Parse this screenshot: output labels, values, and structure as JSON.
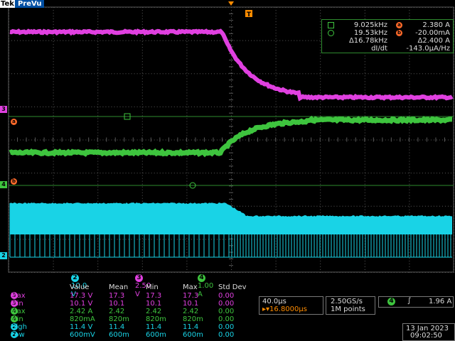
{
  "header": {
    "brand": "Tek",
    "mode": "PreVu"
  },
  "trigger_marker": {
    "label": "T"
  },
  "cursor_readout": {
    "row1": {
      "freq": "9.025kHz",
      "badge": "a",
      "value": "2.380 A"
    },
    "row2": {
      "freq": "19.53kHz",
      "badge": "b",
      "value": "-20.00mA"
    },
    "row3": {
      "freq": "Δ16.78kHz",
      "value": "Δ2.400 A"
    },
    "row4": {
      "label": "dI/dt",
      "value": "-143.0µA/Hz"
    }
  },
  "markers": {
    "ch3": "3",
    "a": "a",
    "ch4": "4",
    "b": "b",
    "ch2": "2"
  },
  "channel_scales": [
    {
      "num": "2",
      "scale": "10.0 V",
      "color": "#19d3e6"
    },
    {
      "num": "3",
      "scale": "2.50 V",
      "color": "#e040e0"
    },
    {
      "num": "4",
      "scale": "1.00 A",
      "color": "#3ec43e"
    }
  ],
  "measurements": {
    "headers": [
      "Value",
      "Mean",
      "Min",
      "Max",
      "Std Dev"
    ],
    "rows": [
      {
        "ch": "3",
        "label": "Max",
        "color": "#e040e0",
        "value": "17.3 V",
        "mean": "17.3",
        "min": "17.3",
        "max": "17.3",
        "std": "0.00"
      },
      {
        "ch": "3",
        "label": "Min",
        "color": "#e040e0",
        "value": "10.1 V",
        "mean": "10.1",
        "min": "10.1",
        "max": "10.1",
        "std": "0.00"
      },
      {
        "ch": "4",
        "label": "Max",
        "color": "#3ec43e",
        "value": "2.42 A",
        "mean": "2.42",
        "min": "2.42",
        "max": "2.42",
        "std": "0.00"
      },
      {
        "ch": "4",
        "label": "Min",
        "color": "#3ec43e",
        "value": "820mA",
        "mean": "820m",
        "min": "820m",
        "max": "820m",
        "std": "0.00"
      },
      {
        "ch": "2",
        "label": "High",
        "color": "#19d3e6",
        "value": "11.4 V",
        "mean": "11.4",
        "min": "11.4",
        "max": "11.4",
        "std": "0.00"
      },
      {
        "ch": "2",
        "label": "Low",
        "color": "#19d3e6",
        "value": "600mV",
        "mean": "600m",
        "min": "600m",
        "max": "600m",
        "std": "0.00"
      }
    ]
  },
  "timebase": {
    "scale": "40.0µs",
    "position": "▸▾16.8000µs"
  },
  "acquisition": {
    "rate": "2.50GS/s",
    "points": "1M points"
  },
  "trigger": {
    "channel": "4",
    "slope": "∫",
    "level": "1.96 A"
  },
  "datetime": {
    "date": "13 Jan  2023",
    "time": "09:02:50"
  },
  "colors": {
    "ch2": "#19d3e6",
    "ch3": "#e040e0",
    "ch4": "#3ec43e",
    "marker": "#ff6a2a"
  }
}
